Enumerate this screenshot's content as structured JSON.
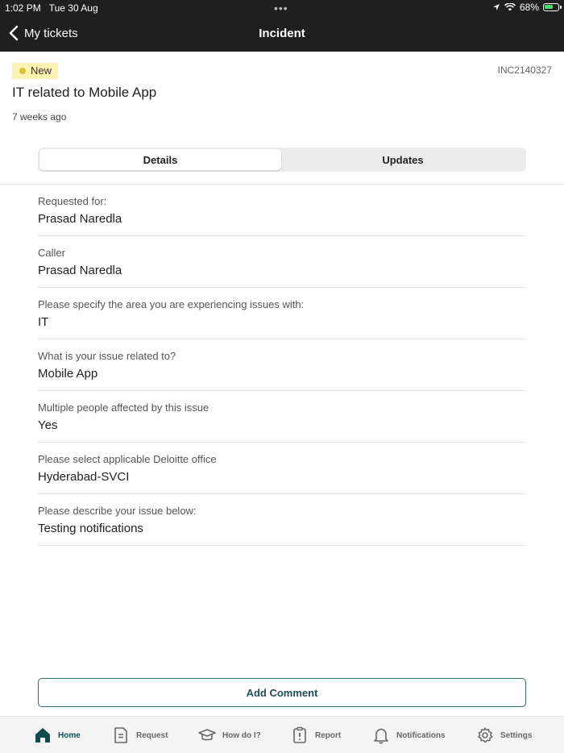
{
  "status_bar": {
    "time": "1:02 PM",
    "date": "Tue 30 Aug",
    "battery_percent": "68%",
    "battery_level": 0.68,
    "icons": [
      "location-arrow-icon",
      "wifi-icon",
      "battery-charging-icon"
    ]
  },
  "nav": {
    "back_label": "My tickets",
    "title": "Incident"
  },
  "ticket": {
    "state": "New",
    "number": "INC2140327",
    "title": "IT related to Mobile App",
    "age": "7 weeks ago"
  },
  "tabs": {
    "details": "Details",
    "updates": "Updates",
    "selected": "Details"
  },
  "fields": [
    {
      "label": "Requested for:",
      "value": "Prasad Naredla"
    },
    {
      "label": "Caller",
      "value": "Prasad Naredla"
    },
    {
      "label": "Please specify the area you are experiencing issues with:",
      "value": "IT"
    },
    {
      "label": "What is your issue related to?",
      "value": "Mobile App"
    },
    {
      "label": "Multiple people affected by this issue",
      "value": "Yes"
    },
    {
      "label": "Please select applicable Deloitte office",
      "value": "Hyderabad-SVCI"
    },
    {
      "label": "Please describe your issue below:",
      "value": "Testing notifications"
    }
  ],
  "add_comment_label": "Add Comment",
  "tabbar": {
    "items": [
      {
        "label": "Home",
        "icon": "home-icon",
        "active": true
      },
      {
        "label": "Request",
        "icon": "document-icon",
        "active": false
      },
      {
        "label": "How do I?",
        "icon": "graduation-cap-icon",
        "active": false
      },
      {
        "label": "Report",
        "icon": "clipboard-alert-icon",
        "active": false
      },
      {
        "label": "Notifications",
        "icon": "bell-icon",
        "active": false
      },
      {
        "label": "Settings",
        "icon": "gear-icon",
        "active": false
      }
    ]
  },
  "colors": {
    "nav_background": "#1f1f1f",
    "badge_background": "#fff3b3",
    "accent": "#0f4a4f",
    "button_border": "#2f6f6f"
  }
}
